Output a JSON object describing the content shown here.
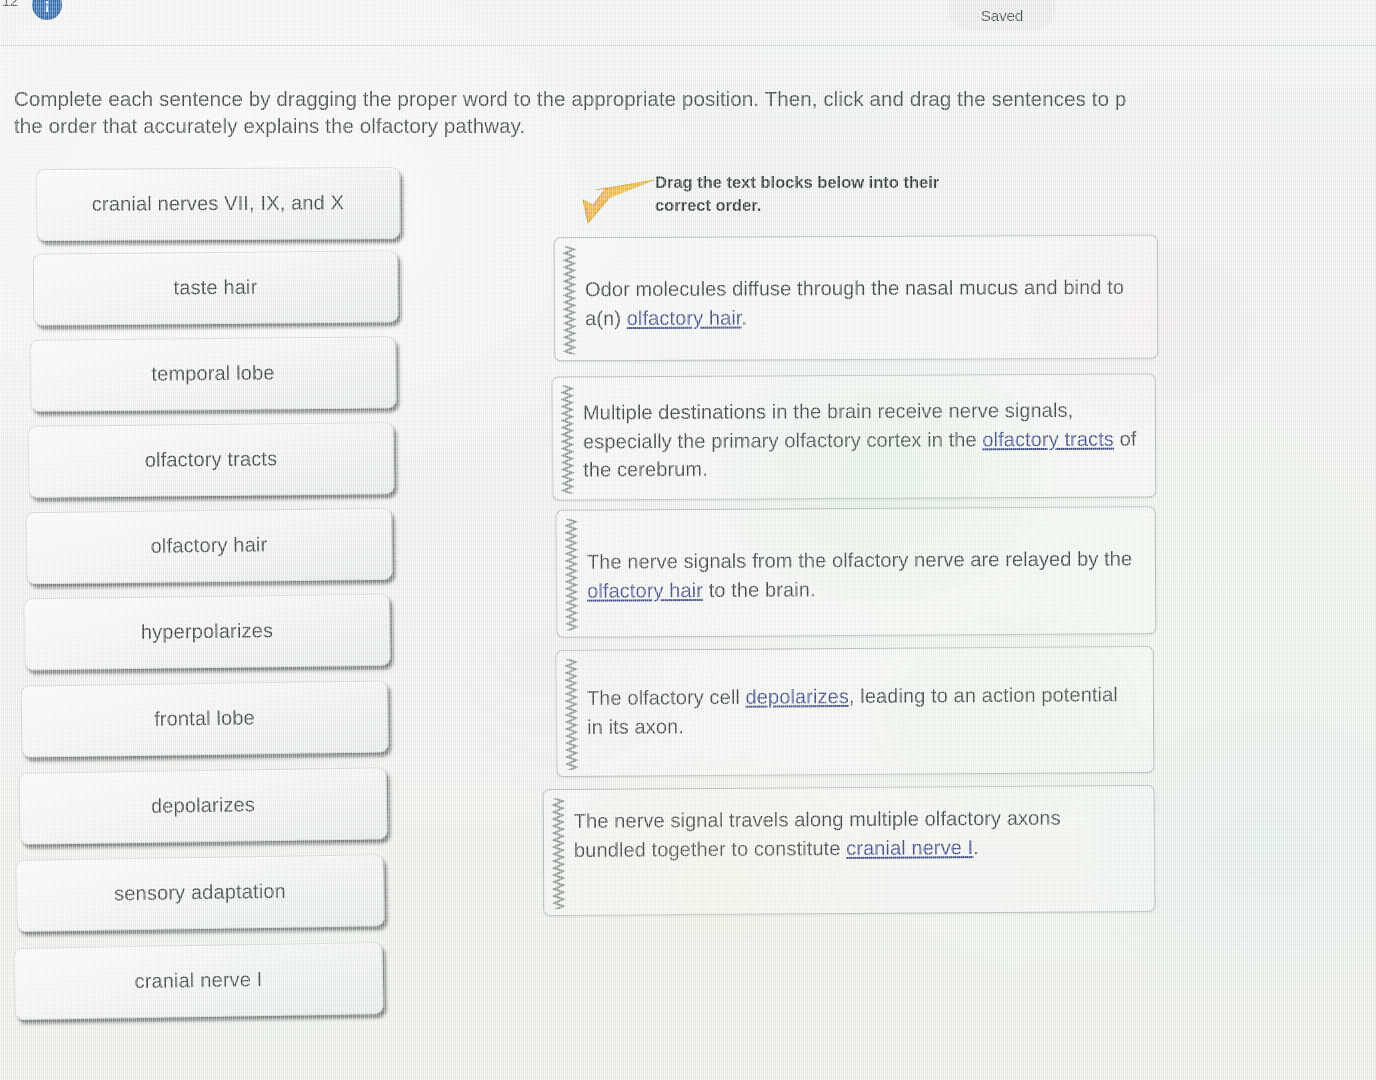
{
  "header": {
    "question_number": "12",
    "info_icon": "info-circle-icon",
    "saved_label": "Saved"
  },
  "prompt": {
    "text": "Complete each sentence by dragging the proper word to the appropriate position. Then, click and drag the sentences to p\nthe order that accurately explains the olfactory pathway."
  },
  "word_bank": {
    "items": [
      {
        "label": "cranial nerves VII, IX, and X"
      },
      {
        "label": "taste hair"
      },
      {
        "label": "temporal lobe"
      },
      {
        "label": "olfactory tracts"
      },
      {
        "label": "olfactory hair"
      },
      {
        "label": "hyperpolarizes"
      },
      {
        "label": "frontal lobe"
      },
      {
        "label": "depolarizes"
      },
      {
        "label": "sensory adaptation"
      },
      {
        "label": "cranial nerve I"
      }
    ]
  },
  "drag_hint": {
    "line1": "Drag the text blocks below into their",
    "line2": "correct order.",
    "arrow_icon": "arrow-pointing-down-left-icon",
    "arrow_color": "#e8a71b"
  },
  "sentence_blocks": [
    {
      "grip_icon": "drag-grip-icon",
      "segments": [
        {
          "text": "Odor molecules diffuse through the nasal mucus and bind to a(n) ",
          "blank": false
        },
        {
          "text": "olfactory hair",
          "blank": true
        },
        {
          "text": ".",
          "blank": false
        }
      ]
    },
    {
      "grip_icon": "drag-grip-icon",
      "segments": [
        {
          "text": "Multiple destinations in the brain receive nerve signals, especially the primary olfactory cortex in the ",
          "blank": false
        },
        {
          "text": "olfactory tracts",
          "blank": true
        },
        {
          "text": " of the cerebrum.",
          "blank": false
        }
      ]
    },
    {
      "grip_icon": "drag-grip-icon",
      "segments": [
        {
          "text": "The nerve signals from the olfactory nerve are relayed by the ",
          "blank": false
        },
        {
          "text": "olfactory hair",
          "blank": true
        },
        {
          "text": " to the brain.",
          "blank": false
        }
      ]
    },
    {
      "grip_icon": "drag-grip-icon",
      "segments": [
        {
          "text": "The olfactory cell ",
          "blank": false
        },
        {
          "text": "depolarizes",
          "blank": true
        },
        {
          "text": ", leading to an action potential in its axon.",
          "blank": false
        }
      ]
    },
    {
      "grip_icon": "drag-grip-icon",
      "segments": [
        {
          "text": "The nerve signal travels along multiple olfactory axons bundled together to constitute ",
          "blank": false
        },
        {
          "text": "cranial nerve I",
          "blank": true
        },
        {
          "text": ".",
          "blank": false
        }
      ]
    }
  ]
}
